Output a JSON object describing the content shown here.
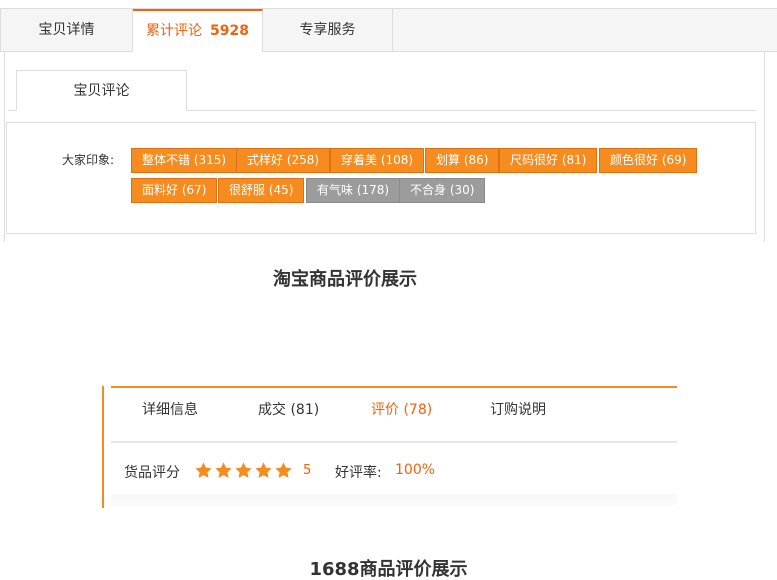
{
  "taobao": {
    "tabs": [
      {
        "label": "宝贝详情"
      },
      {
        "label": "累计评论",
        "count": "5928"
      },
      {
        "label": "专享服务"
      }
    ],
    "sub_tab": "宝贝评论",
    "impression_label": "大家印象:",
    "tags": [
      {
        "label": "整体不错 (315)",
        "style": "orange"
      },
      {
        "label": "式样好 (258)",
        "style": "orange"
      },
      {
        "label": "穿着美 (108)",
        "style": "orange"
      },
      {
        "label": "划算 (86)",
        "style": "orange"
      },
      {
        "label": "尺码很好 (81)",
        "style": "orange"
      },
      {
        "label": "颜色很好 (69)",
        "style": "orange"
      },
      {
        "label": "面料好 (67)",
        "style": "orange"
      },
      {
        "label": "很舒服 (45)",
        "style": "orange"
      },
      {
        "label": "有气味 (178)",
        "style": "gray"
      },
      {
        "label": "不合身 (30)",
        "style": "gray"
      }
    ],
    "caption": "淘宝商品评价展示"
  },
  "alibaba": {
    "tabs": [
      {
        "label": "详细信息"
      },
      {
        "label": "成交 (81)"
      },
      {
        "label": "评价 (78)",
        "active": true
      },
      {
        "label": "订购说明"
      }
    ],
    "score_label": "货品评分",
    "stars": 5,
    "score_value": "5",
    "rate_label": "好评率:",
    "rate_value": "100%",
    "caption": "1688商品评价展示"
  },
  "colors": {
    "accent": "#f0620d",
    "tag_orange": "#f68b1f",
    "tag_gray": "#9c9c9c",
    "star": "#f68b1f"
  },
  "icons": {
    "star": "star-icon"
  }
}
